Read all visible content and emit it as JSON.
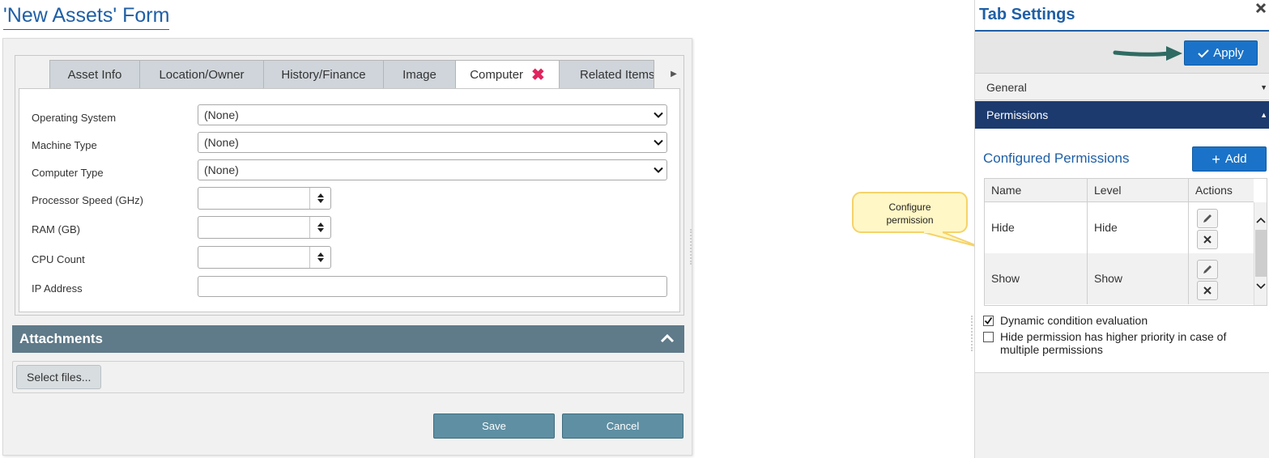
{
  "form": {
    "title": "'New Assets' Form",
    "tabs": [
      {
        "label": "Asset Info"
      },
      {
        "label": "Location/Owner"
      },
      {
        "label": "History/Finance"
      },
      {
        "label": "Image"
      },
      {
        "label": "Computer",
        "active": true
      },
      {
        "label": "Related Items"
      }
    ],
    "fields": {
      "os_label": "Operating System",
      "os_value": "(None)",
      "machine_label": "Machine Type",
      "machine_value": "(None)",
      "computer_label": "Computer Type",
      "computer_value": "(None)",
      "processor_label": "Processor Speed (GHz)",
      "ram_label": "RAM (GB)",
      "cpu_label": "CPU Count",
      "ip_label": "IP Address"
    },
    "attachments_title": "Attachments",
    "select_files_label": "Select files...",
    "save_label": "Save",
    "cancel_label": "Cancel"
  },
  "callout": {
    "line1": "Configure",
    "line2": "permission"
  },
  "panel": {
    "title": "Tab Settings",
    "apply_label": "Apply",
    "general_label": "General",
    "permissions_label": "Permissions",
    "configured_title": "Configured Permissions",
    "add_label": "Add",
    "columns": {
      "name": "Name",
      "level": "Level",
      "actions": "Actions"
    },
    "rows": [
      {
        "name": "Hide",
        "level": "Hide"
      },
      {
        "name": "Show",
        "level": "Show"
      }
    ],
    "dynamic_label": "Dynamic condition evaluation",
    "dynamic_checked": true,
    "priority_label": "Hide permission has higher priority in case of multiple permissions",
    "priority_checked": false
  },
  "colors": {
    "brand_blue": "#1f5fa6",
    "button_blue": "#1a73c8",
    "header_navy": "#1c3a6e",
    "attach_header": "#5f7a89",
    "teal_button": "#5f8fa3",
    "delete_red": "#e0245e",
    "arrow_green": "#2f6b62"
  }
}
